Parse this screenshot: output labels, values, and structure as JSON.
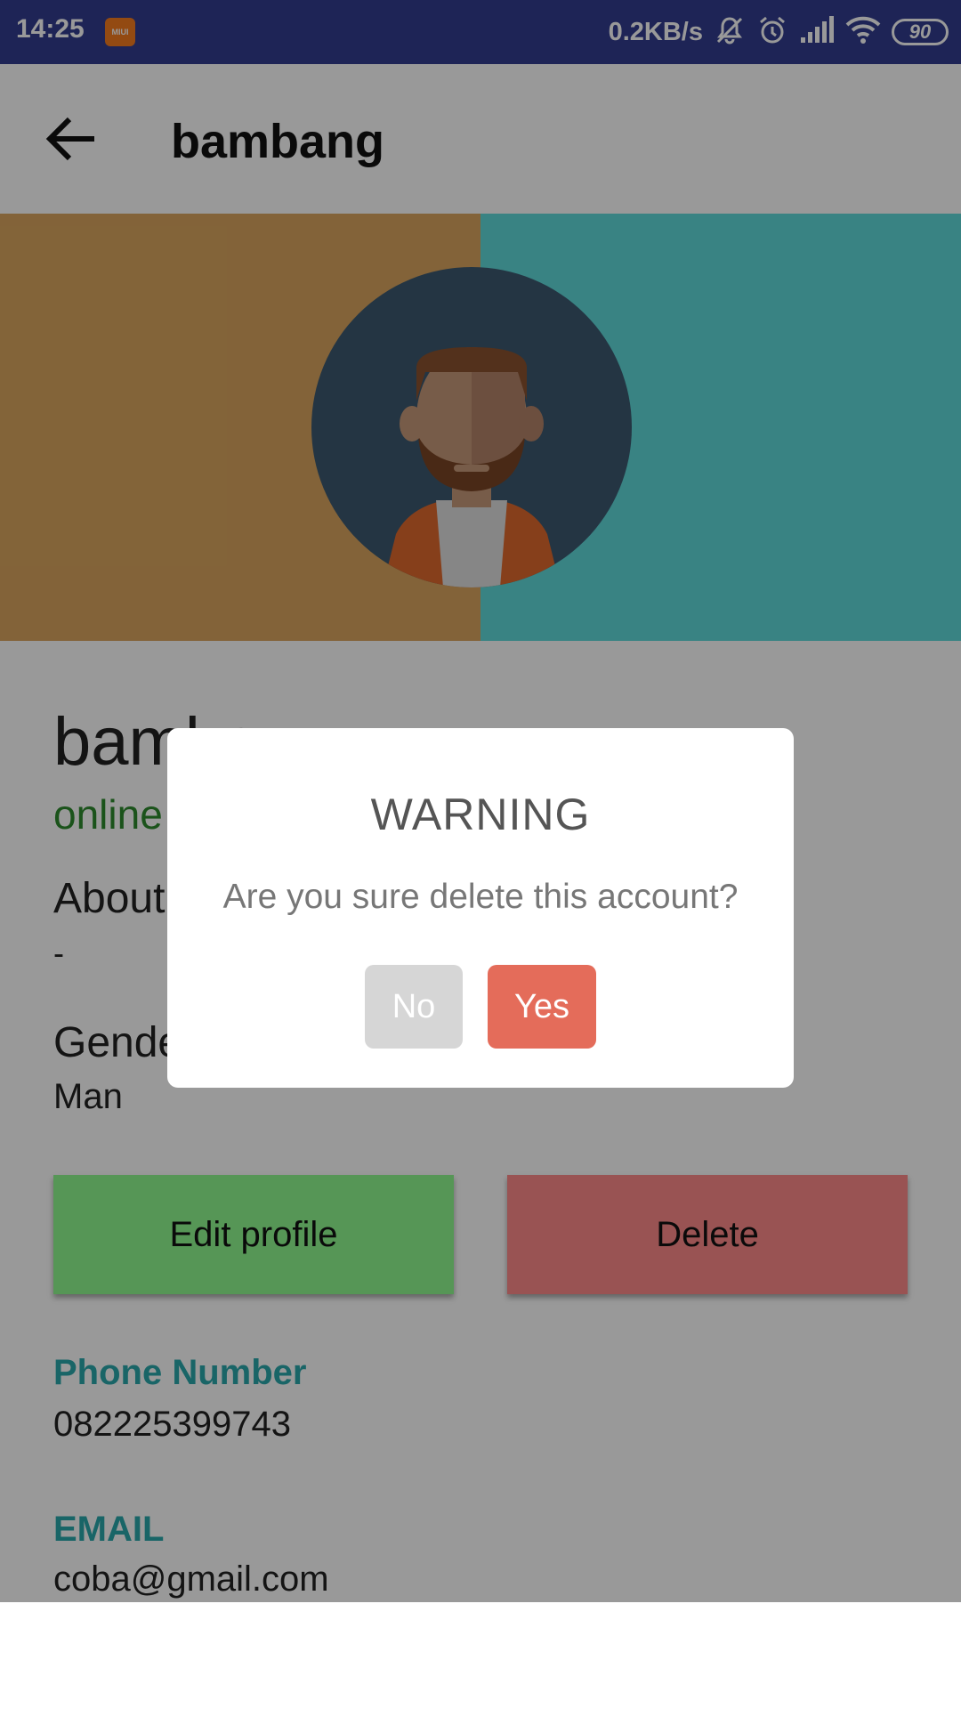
{
  "status_bar": {
    "time": "14:25",
    "app_badge": "MIUI",
    "net_speed": "0.2KB/s",
    "battery": "90"
  },
  "app_bar": {
    "title": "bambang"
  },
  "profile": {
    "name": "bambang",
    "status": "online",
    "about_label": "About",
    "about_value": "-",
    "gender_label": "Gender",
    "gender_value": "Man",
    "edit_button": "Edit profile",
    "delete_button": "Delete",
    "phone_label": "Phone Number",
    "phone_value": "082225399743",
    "email_label": "EMAIL",
    "email_value": "coba@gmail.com"
  },
  "dialog": {
    "title": "WARNING",
    "message": "Are you sure delete this account?",
    "no_label": "No",
    "yes_label": "Yes"
  },
  "colors": {
    "status_bar": "#333d8f",
    "banner_left": "#dba65f",
    "banner_right": "#5fdada",
    "online": "#2e8b2e",
    "edit_button": "#8ffa8f",
    "delete_button": "#ff8a8a",
    "section_label": "#2aa8ac",
    "dialog_yes": "#e46c5a",
    "dialog_no": "#d6d6d6"
  }
}
